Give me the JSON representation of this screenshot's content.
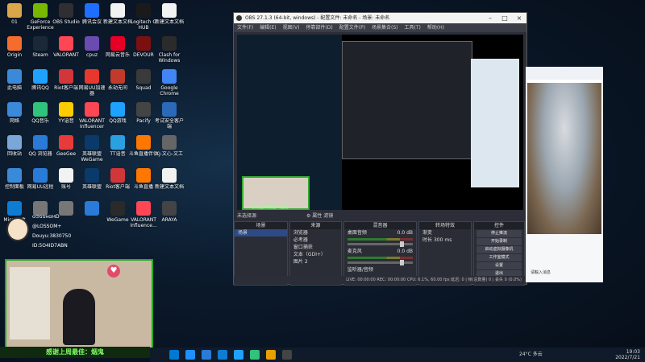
{
  "desktop": {
    "icons": [
      {
        "label": "01",
        "color": "#d9a74a"
      },
      {
        "label": "GeForce Experience",
        "color": "#76b900"
      },
      {
        "label": "OBS Studio",
        "color": "#302e31"
      },
      {
        "label": "腾讯会议",
        "color": "#1e6fff"
      },
      {
        "label": "新建文本文档",
        "color": "#f2f2f2"
      },
      {
        "label": "Logitech G HUB",
        "color": "#1a1a1a"
      },
      {
        "label": "新建文本文档",
        "color": "#f2f2f2"
      },
      {
        "label": "Origin",
        "color": "#f56c2d"
      },
      {
        "label": "Steam",
        "color": "#1b2838"
      },
      {
        "label": "VALORANT",
        "color": "#ff4655"
      },
      {
        "label": "cpuz",
        "color": "#6a4bb0"
      },
      {
        "label": "网易云音乐",
        "color": "#e60026"
      },
      {
        "label": "DEVOUR",
        "color": "#7a1010"
      },
      {
        "label": "Clash for Windows",
        "color": "#2b2b2b"
      },
      {
        "label": "此电脑",
        "color": "#3b8ad9"
      },
      {
        "label": "腾讯QQ",
        "color": "#1fa2ff"
      },
      {
        "label": "Riot客户端",
        "color": "#d13639"
      },
      {
        "label": "网易UU加速器",
        "color": "#e8372d"
      },
      {
        "label": "永劫无间",
        "color": "#c23a2a"
      },
      {
        "label": "Squad",
        "color": "#3a3a3a"
      },
      {
        "label": "Google Chrome",
        "color": "#4285f4"
      },
      {
        "label": "网络",
        "color": "#3b8ad9"
      },
      {
        "label": "QQ音乐",
        "color": "#31c27c"
      },
      {
        "label": "YY语音",
        "color": "#ffcc00"
      },
      {
        "label": "VALORANT Influencer",
        "color": "#ff4655"
      },
      {
        "label": "QQ游戏",
        "color": "#1fa2ff"
      },
      {
        "label": "Pacify",
        "color": "#444"
      },
      {
        "label": "考试安全客户端",
        "color": "#2a6ab8"
      },
      {
        "label": "回收站",
        "color": "#7aa7d8"
      },
      {
        "label": "QQ 浏览器",
        "color": "#2a7bd8"
      },
      {
        "label": "GeeGee",
        "color": "#e83a3a"
      },
      {
        "label": "英雄联盟WeGame",
        "color": "#0a3a6a"
      },
      {
        "label": "TT语音",
        "color": "#2aa0e0"
      },
      {
        "label": "斗鱼直播伴侣",
        "color": "#ff7700"
      },
      {
        "label": "XJ-文心-文工",
        "color": "#666"
      },
      {
        "label": "控制面板",
        "color": "#3b8ad9"
      },
      {
        "label": "网易UU远程",
        "color": "#2a7bd8"
      },
      {
        "label": "账号",
        "color": "#f2f2f2"
      },
      {
        "label": "英雄联盟",
        "color": "#0a3a6a"
      },
      {
        "label": "Riot客户端",
        "color": "#d13639"
      },
      {
        "label": "斗鱼直播",
        "color": "#ff7700"
      },
      {
        "label": "新建文本文档",
        "color": "#f2f2f2"
      },
      {
        "label": "Microsoft Edge",
        "color": "#0f7cd4"
      },
      {
        "label": "",
        "color": "#777"
      },
      {
        "label": "",
        "color": "#777"
      },
      {
        "label": "",
        "color": "#2a7bd8"
      },
      {
        "label": "WeGame",
        "color": "#2a2a2a"
      },
      {
        "label": "VALORANT Influence...",
        "color": "#ff4655"
      },
      {
        "label": "ARAYA",
        "color": "#444"
      }
    ]
  },
  "obs": {
    "title": "OBS 27.1.3 (64-bit, windows) - 配置文件: 未命名 - 场景: 未命名",
    "menu": [
      "文件(F)",
      "编辑(E)",
      "视图(V)",
      "停靠部件(D)",
      "配置文件(P)",
      "场景集合(S)",
      "工具(T)",
      "帮助(H)"
    ],
    "scene_bar_label": "未选择源",
    "scene_bar_btns": [
      "⚙ 属性",
      "滤镜"
    ],
    "docks": {
      "scenes": {
        "title": "场景",
        "items": [
          "场景"
        ]
      },
      "sources": {
        "title": "来源",
        "items": [
          "浏览器",
          "必考器",
          "",
          "窗口捕获",
          "文本（GDI+）",
          "图片 2"
        ]
      },
      "mixer": {
        "title": "混音器",
        "items": [
          {
            "name": "桌面音频",
            "db": "0.0 dB"
          },
          {
            "name": "麦克风",
            "db": "0.0 dB"
          }
        ],
        "monitor": "监听器/音频"
      },
      "transitions": {
        "title": "转场特效",
        "type": "渐变",
        "duration_label": "时长",
        "duration": "300 ms"
      },
      "controls": {
        "title": "控件",
        "buttons": [
          "停止推流",
          "开始录制",
          "启动虚拟摄像机",
          "工作室模式",
          "设置",
          "退出"
        ]
      }
    },
    "status": "LIVE: 00:00:00   REC: 00:00:00   CPU: 6.1%, 60.00 fps   延迟: 0 | 帧(总数量) 0 | 丢失 0 (0.0%)"
  },
  "chat": {
    "bottom_text": "请輸入消息"
  },
  "stream": {
    "lines": [
      "ɢ⊙ɢɢʜɢⲘD",
      "@LOSSOM+",
      "Douyu:3830750",
      "ID:5O4ID7ABN"
    ],
    "heart": "♥",
    "banner": "感谢上周最佳：烟鬼"
  },
  "taskbar": {
    "weather": "24°C 多云",
    "time": "19:03",
    "date": "2022/7/21",
    "apps": [
      "#0078d4",
      "#1e90ff",
      "#2a7bd8",
      "#0f7cd4",
      "#1fa2ff",
      "#31c27c",
      "#e8a000",
      "#444"
    ]
  }
}
